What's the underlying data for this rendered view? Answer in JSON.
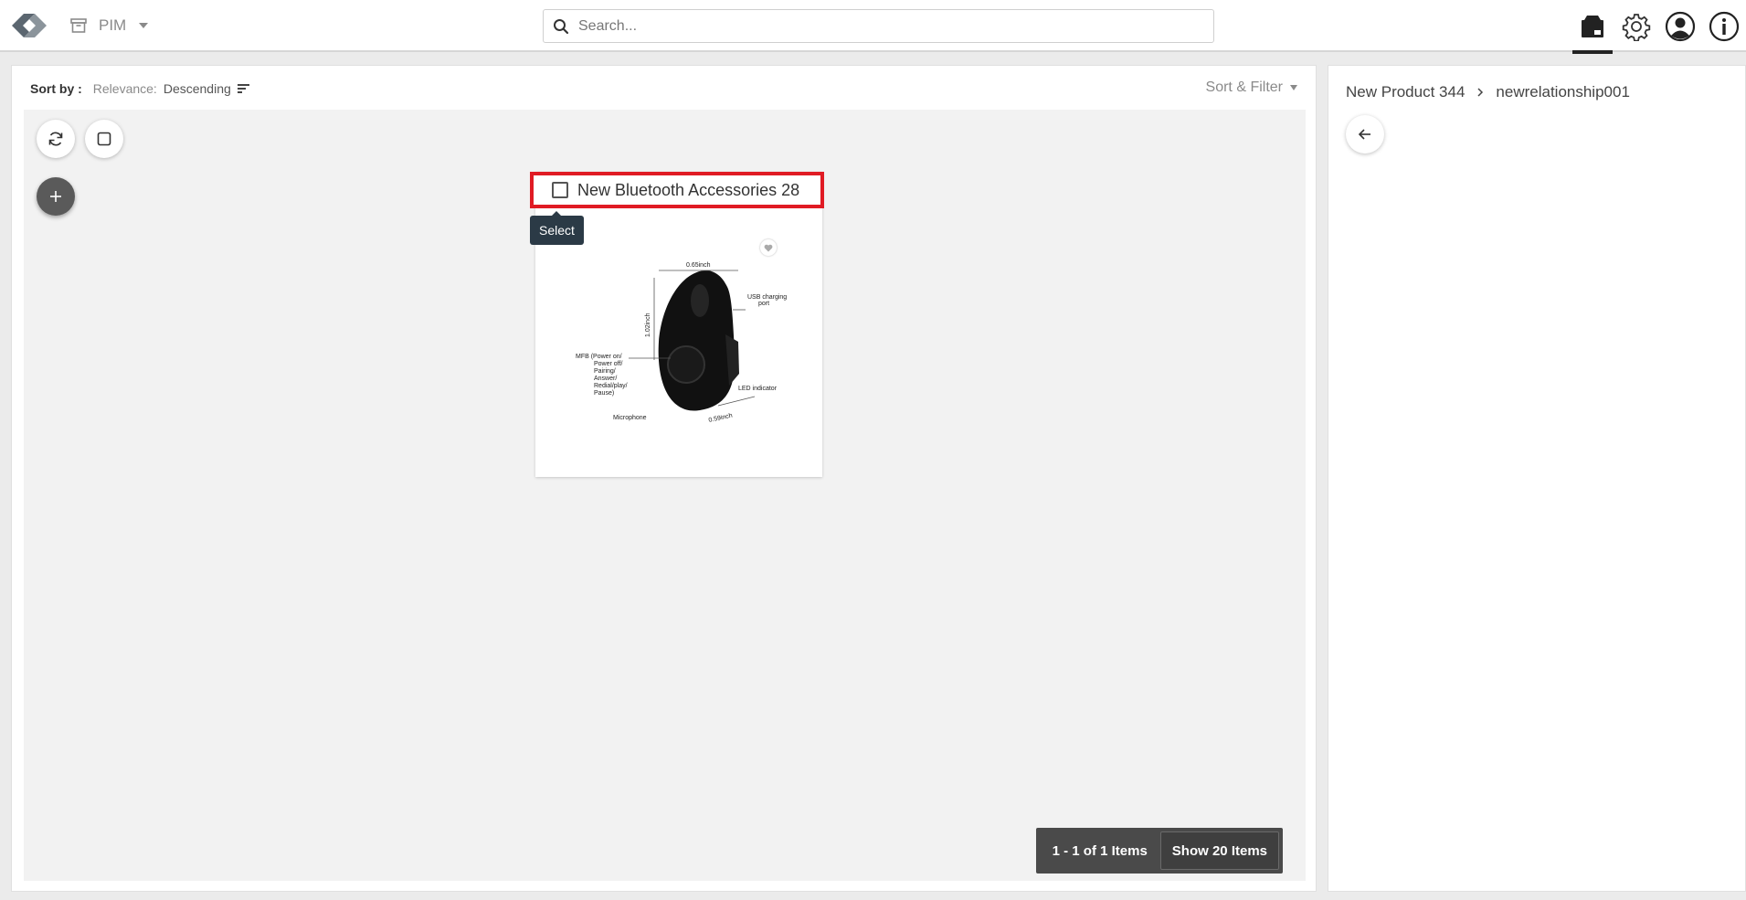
{
  "topbar": {
    "app_label": "PIM",
    "icons": [
      "logo-icon",
      "archive-icon",
      "chevron-down-icon",
      "search-icon",
      "product-box-icon",
      "gear-icon",
      "user-icon",
      "info-icon"
    ]
  },
  "search": {
    "placeholder": "Search...",
    "value": ""
  },
  "sort": {
    "title": "Sort by :",
    "field": "Relevance:",
    "direction": "Descending",
    "filter_label": "Sort & Filter"
  },
  "card": {
    "title": "New Bluetooth Accessories 28",
    "tooltip": "Select",
    "image_labels": {
      "width": "0.65inch",
      "height": "1.02inch",
      "usb": "USB charging",
      "usb2": "port",
      "mfb": "MFB (Power on/",
      "mfb2": "Power off/",
      "mfb3": "Pairing/",
      "mfb4": "Answer/",
      "mfb5": "Redial/play/",
      "mfb6": "Pause)",
      "led": "LED indicator",
      "mic": "Microphone",
      "depth": "0.59inch"
    }
  },
  "pager": {
    "count": "1 - 1 of 1 Items",
    "show": "Show 20 Items"
  },
  "side": {
    "crumb_parent": "New Product 344",
    "crumb_current": "newrelationship001"
  },
  "colors": {
    "highlight": "#e01b24",
    "tooltip_bg": "#2b3a46",
    "pager_bg": "#4a4a4a"
  }
}
